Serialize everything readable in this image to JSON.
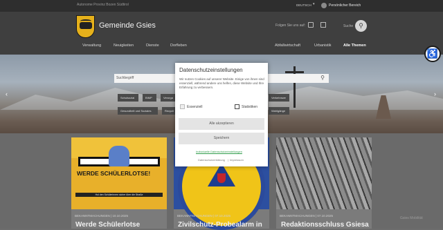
{
  "topbar": {
    "province": "Autonome Provinz Bozen Südtirol",
    "language": "DEUTSCH",
    "personal_area": "Persönlicher Bereich"
  },
  "header": {
    "brand": "Gemeinde Gsies",
    "follow_label": "Folgen Sie uns auf:",
    "search_label": "Suche",
    "nav_left": [
      "Verwaltung",
      "Neuigkeiten",
      "Dienste",
      "Dorfleben"
    ],
    "nav_right": [
      "Abfallwirtschaft",
      "Urbanistik",
      "Alle Themen"
    ]
  },
  "hero": {
    "search_placeholder": "Suchbegriff",
    "tags_row1": [
      "Schulsozial",
      "BIMP",
      "Verorga"
    ],
    "tags_row2": [
      "Gesundheit und Soziales",
      "Recycli"
    ],
    "tag_right1": "Verkehrswe",
    "tag_right2": "Wahlgänge"
  },
  "cards": [
    {
      "image_headline": "WERDE SCHÜLERLOTSE!",
      "image_sub": "Hol den Schülerinnen sicher über die Straße",
      "meta": "BEKANNTMACHUNGEN | 10.10.2025",
      "title": "Werde Schülerlotse"
    },
    {
      "meta": "BEKANNTMACHUNGEN | 07.10.2025",
      "title": "Zivilschutz-Probealarm in"
    },
    {
      "meta": "BEKANNTMACHUNGEN | 07.10.2025",
      "title": "Redaktionsschluss Gsiesa"
    }
  ],
  "watermark": "Gsies Mobilität",
  "modal": {
    "title": "Datenschutzeinstellungen",
    "text": "Wir nutzen Cookies auf unserer Website. Einige von ihnen sind essenziell, während andere uns helfen, diese Website und Ihre Erfahrung zu verbessern.",
    "essential_label": "Essenziell",
    "statistics_label": "Statistiken",
    "accept_all": "Alle akzeptieren",
    "save": "Speichern",
    "individual_link": "Individuelle Datenschutzeinstellungen",
    "privacy_link": "Datenschutzerklärung",
    "imprint_link": "Impressum",
    "separator": "|",
    "link_color": "#2e9c4a"
  }
}
